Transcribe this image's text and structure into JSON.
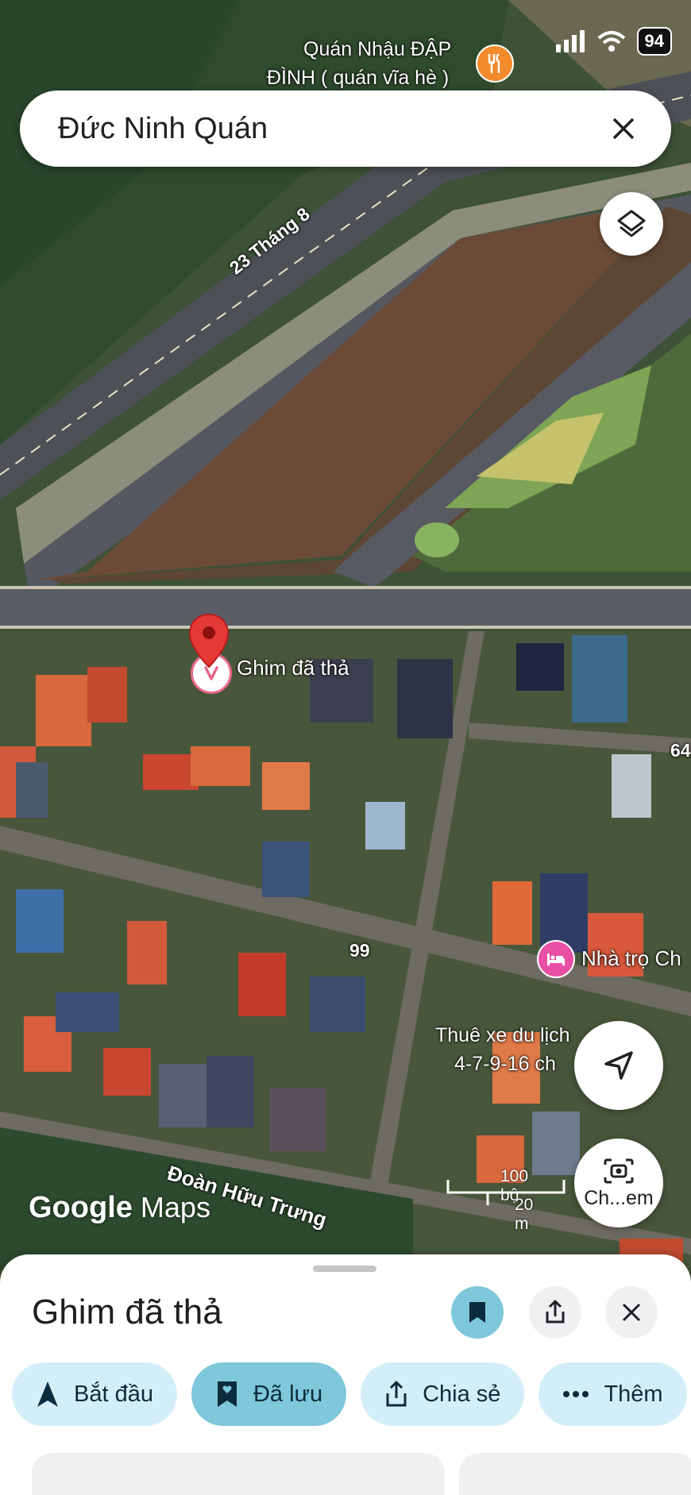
{
  "status_bar": {
    "battery": "94"
  },
  "search": {
    "query": "Đức Ninh Quán"
  },
  "map": {
    "poi_restaurant": {
      "line1": "Quán Nhậu ĐẬP",
      "line2": "ĐÌNH ( quán vĩa hè )"
    },
    "road_23_thang_8": "23 Tháng 8",
    "dropped_pin_label": "Ghim đã thả",
    "road_number_64": "64",
    "road_number_99": "99",
    "poi_hotel": "Nhà trọ Ch",
    "poi_car_rental": {
      "line1": "Thuê xe du lịch",
      "line2": "4-7-9-16 ch"
    },
    "road_doan_huu_trung": "Đoàn Hữu Trưng",
    "watermark": {
      "google": "Google",
      "maps": "Maps"
    },
    "scale": {
      "feet": "100 bộ",
      "meters": "20 m"
    },
    "camera_button_label": "Ch...em"
  },
  "sheet": {
    "title": "Ghim đã thả",
    "chips": [
      {
        "label": "Bắt đầu",
        "icon": "navigation-arrow-icon"
      },
      {
        "label": "Đã lưu",
        "icon": "bookmark-icon"
      },
      {
        "label": "Chia sẻ",
        "icon": "share-icon"
      },
      {
        "label": "Thêm",
        "icon": "more-icon"
      }
    ]
  },
  "colors": {
    "pin_red": "#e53935",
    "chip_bg": "#d3eef8",
    "chip_active": "#7fc7db",
    "restaurant_orange": "#f28b2c",
    "hotel_pink": "#e84fa5"
  }
}
